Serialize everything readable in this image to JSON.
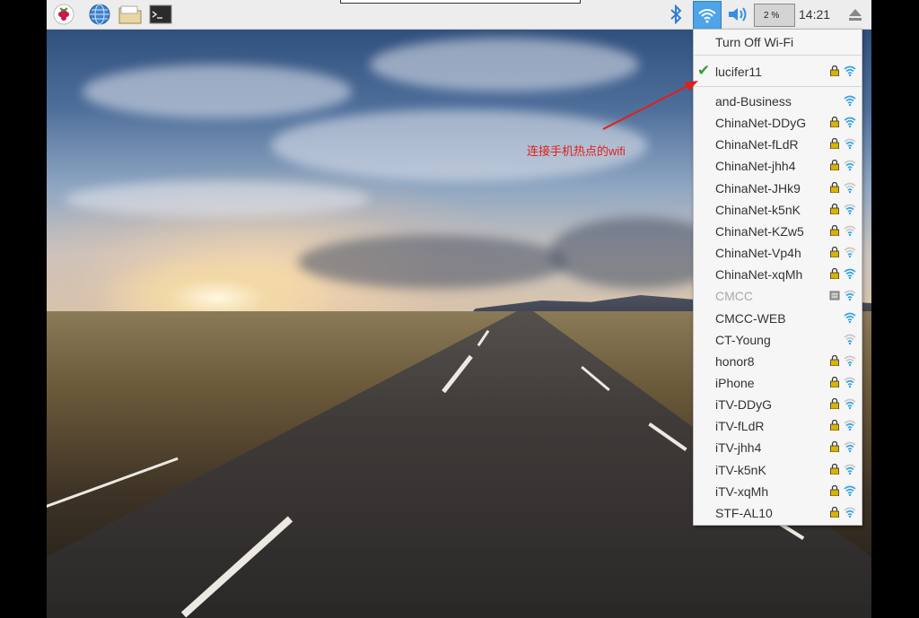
{
  "taskbar": {
    "clock": "14:21",
    "cpu": "2 %",
    "icons": [
      "raspberry-menu-icon",
      "web-browser-icon",
      "file-manager-icon",
      "terminal-icon",
      "bluetooth-icon",
      "wifi-icon",
      "volume-icon",
      "cpu-monitor-icon",
      "eject-icon"
    ]
  },
  "wifi_menu": {
    "turn_off_label": "Turn Off Wi-Fi",
    "connected": {
      "ssid": "lucifer11",
      "locked": true,
      "signal": 3
    },
    "networks": [
      {
        "ssid": "and-Business",
        "locked": false,
        "signal": 3
      },
      {
        "ssid": "ChinaNet-DDyG",
        "locked": true,
        "signal": 3
      },
      {
        "ssid": "ChinaNet-fLdR",
        "locked": true,
        "signal": 2
      },
      {
        "ssid": "ChinaNet-jhh4",
        "locked": true,
        "signal": 2
      },
      {
        "ssid": "ChinaNet-JHk9",
        "locked": true,
        "signal": 1
      },
      {
        "ssid": "ChinaNet-k5nK",
        "locked": true,
        "signal": 2
      },
      {
        "ssid": "ChinaNet-KZw5",
        "locked": true,
        "signal": 1
      },
      {
        "ssid": "ChinaNet-Vp4h",
        "locked": true,
        "signal": 1
      },
      {
        "ssid": "ChinaNet-xqMh",
        "locked": true,
        "signal": 3
      },
      {
        "ssid": "CMCC",
        "locked": false,
        "signal": 2,
        "disabled": true,
        "enterprise": true
      },
      {
        "ssid": "CMCC-WEB",
        "locked": false,
        "signal": 3
      },
      {
        "ssid": "CT-Young",
        "locked": false,
        "signal": 1
      },
      {
        "ssid": "honor8",
        "locked": true,
        "signal": 1
      },
      {
        "ssid": "iPhone",
        "locked": true,
        "signal": 2
      },
      {
        "ssid": "iTV-DDyG",
        "locked": true,
        "signal": 2
      },
      {
        "ssid": "iTV-fLdR",
        "locked": true,
        "signal": 2
      },
      {
        "ssid": "iTV-jhh4",
        "locked": true,
        "signal": 2
      },
      {
        "ssid": "iTV-k5nK",
        "locked": true,
        "signal": 2
      },
      {
        "ssid": "iTV-xqMh",
        "locked": true,
        "signal": 3
      },
      {
        "ssid": "STF-AL10",
        "locked": true,
        "signal": 2
      }
    ]
  },
  "annotation": {
    "text": "连接手机热点的wifi",
    "color": "#e0201c"
  },
  "colors": {
    "accent": "#4ea4e6",
    "check": "#3e9a3e",
    "lock": "#d8b400"
  }
}
